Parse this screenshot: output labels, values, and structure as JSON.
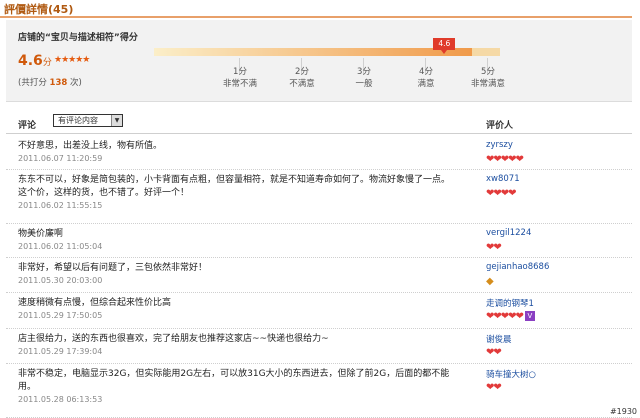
{
  "page": {
    "title": "評價詳情(45)"
  },
  "score": {
    "heading": "店铺的“宝贝与描述相符”得分",
    "value": "4.6",
    "unit": "分",
    "stars": "★★★★★",
    "total_prefix": "(共打分",
    "total_count": "138",
    "total_suffix": "次)",
    "marker_label": "4.6",
    "level_fraction": 0.92,
    "scale": [
      {
        "value": "1分",
        "desc": "非常不满"
      },
      {
        "value": "2分",
        "desc": "不满意"
      },
      {
        "value": "3分",
        "desc": "一般"
      },
      {
        "value": "4分",
        "desc": "满意"
      },
      {
        "value": "5分",
        "desc": "非常满意"
      }
    ]
  },
  "list": {
    "comment_label": "评论",
    "filter_value": "有评论内容",
    "reviewer_label": "评价人"
  },
  "reviews": [
    {
      "text": "不好意思，出差没上线，物有所值。",
      "date": "2011.06.07 11:20:59",
      "user": "zyrszy",
      "rank": "❤❤❤❤❤",
      "rank_type": "heart"
    },
    {
      "text": "东东不可以，好象是简包装的，小卡背面有点粗，但容量相符，就是不知道寿命如何了。物流好象慢了一点。这个价，这样的货，也不错了。好评一个！",
      "date": "2011.06.02 11:55:15",
      "user": "xw8071",
      "rank": "❤❤❤❤",
      "rank_type": "heart"
    },
    {
      "text": "物美价廉啊",
      "date": "2011.06.02 11:05:04",
      "user": "vergil1224",
      "rank": "❤❤",
      "rank_type": "heart"
    },
    {
      "text": "非常好，希望以后有问题了，三包依然非常好！",
      "date": "2011.05.30 20:03:00",
      "user": "gejianhao8686",
      "rank": "◆",
      "rank_type": "diamond"
    },
    {
      "text": "速度稍微有点慢，但综合起来性价比高",
      "date": "2011.05.29 17:50:05",
      "user": "走调的钢琴1",
      "rank": "❤❤❤❤❤",
      "rank_type": "heart_vip",
      "vip_label": "V"
    },
    {
      "text": "店主很给力，送的东西也很喜欢，完了给朋友也推荐这家店~~快递也很给力~",
      "date": "2011.05.29 17:39:04",
      "user": "谢俊晨",
      "rank": "❤❤",
      "rank_type": "heart"
    },
    {
      "text": "非常不稳定，电脑显示32G，但实际能用2G左右，可以放31G大小的东西进去，但除了前2G，后面的都不能用。",
      "date": "2011.05.28 06:13:53",
      "user": "骑车撞大树○",
      "rank": "❤❤",
      "rank_type": "heart"
    }
  ],
  "watermark": "#1930"
}
